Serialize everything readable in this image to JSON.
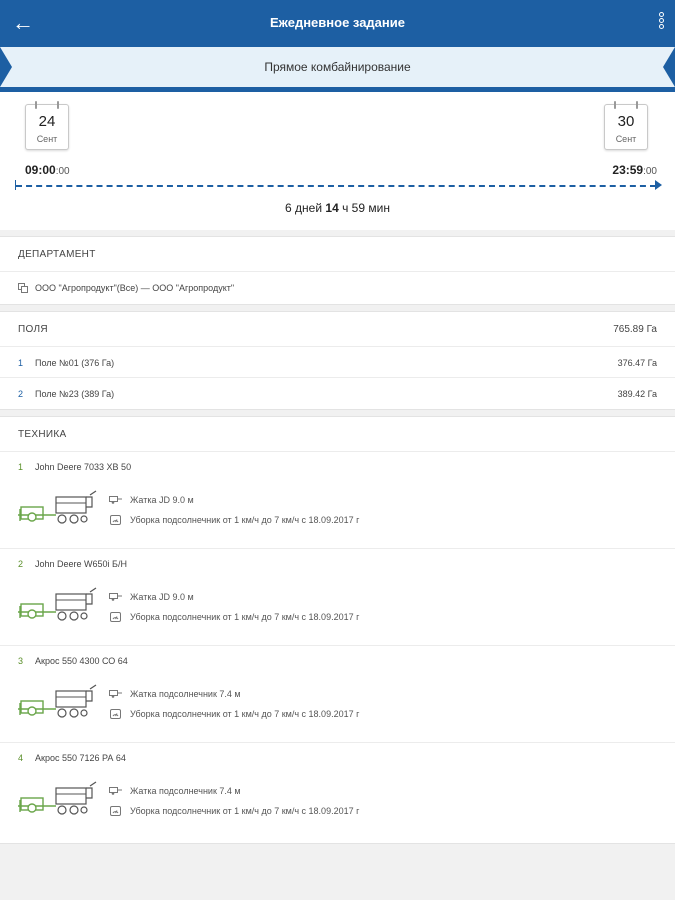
{
  "app": {
    "title": "Ежедневное задание",
    "back_icon": "arrow-left-icon",
    "more_icon": "more-vertical-icon",
    "accent_color": "#1d5fa3"
  },
  "operation": "Прямое комбайнирование",
  "period": {
    "start": {
      "day": "24",
      "month": "Сент",
      "time_main": "09:00",
      "time_sec": ":00"
    },
    "end": {
      "day": "30",
      "month": "Сент",
      "time_main": "23:59",
      "time_sec": ":00"
    },
    "duration_pre": "6 дней ",
    "duration_bold": "14",
    "duration_post": " ч 59 мин"
  },
  "department": {
    "header": "ДЕПАРТАМЕНТ",
    "icon": "copy-icon",
    "text": "ООО \"Агропродукт\"(Все) — ООО \"Агропродукт\""
  },
  "fields": {
    "header": "ПОЛЯ",
    "total": "765.89 Га",
    "items": [
      {
        "num": "1",
        "name": "Поле №01 (376 Га)",
        "area": "376.47 Га"
      },
      {
        "num": "2",
        "name": "Поле №23 (389 Га)",
        "area": "389.42 Га"
      }
    ]
  },
  "machinery": {
    "header": "ТЕХНИКА",
    "items": [
      {
        "num": "1",
        "name": "John Deere 7033 ХВ 50",
        "implement": "Жатка JD 9.0 м",
        "norm": "Уборка подсолнечник от 1 км/ч до 7 км/ч с 18.09.2017 г"
      },
      {
        "num": "2",
        "name": "John Deere W650i Б/Н",
        "implement": "Жатка JD 9.0 м",
        "norm": "Уборка подсолнечник от 1 км/ч до 7 км/ч с 18.09.2017 г"
      },
      {
        "num": "3",
        "name": "Акрос 550 4300 СО 64",
        "implement": "Жатка подсолнечник 7.4 м",
        "norm": "Уборка подсолнечник от 1 км/ч до 7 км/ч с 18.09.2017 г"
      },
      {
        "num": "4",
        "name": "Акрос 550 7126 РА 64",
        "implement": "Жатка подсолнечник 7.4 м",
        "norm": "Уборка подсолнечник от 1 км/ч до 7 км/ч с 18.09.2017 г"
      }
    ]
  }
}
